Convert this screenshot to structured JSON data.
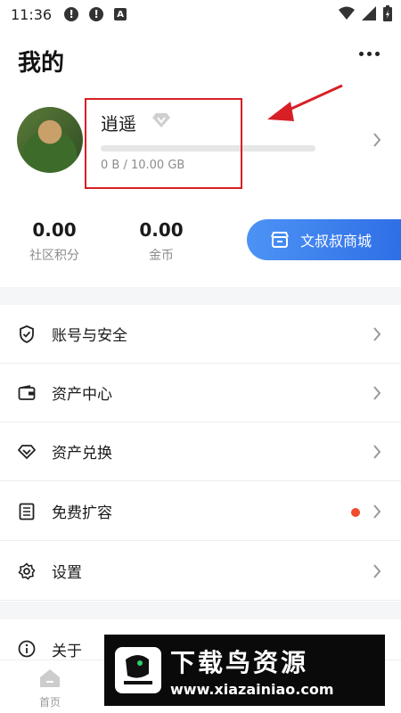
{
  "status_bar": {
    "time": "11:36",
    "ab_label": "A"
  },
  "header": {
    "title": "我的"
  },
  "profile": {
    "username": "逍遥",
    "storage_text": "0 B / 10.00 GB",
    "storage_used_fraction": 0.0
  },
  "stats": {
    "points_value": "0.00",
    "points_label": "社区积分",
    "coins_value": "0.00",
    "coins_label": "金币"
  },
  "shop": {
    "label": "文叔叔商城"
  },
  "menu": [
    {
      "label": "账号与安全",
      "icon": "shield-icon"
    },
    {
      "label": "资产中心",
      "icon": "wallet-icon"
    },
    {
      "label": "资产兑换",
      "icon": "diamond-icon"
    },
    {
      "label": "免费扩容",
      "icon": "list-icon",
      "badge_color": "#f04b2e"
    },
    {
      "label": "设置",
      "icon": "gear-icon"
    },
    {
      "label": "关于",
      "icon": "info-icon"
    }
  ],
  "tabs": [
    {
      "label": "首页",
      "icon": "home-icon"
    }
  ],
  "watermark": {
    "title": "下载鸟资源",
    "url": "www.xiazainiao.com"
  },
  "colors": {
    "accent": "#3b82f6",
    "annotation": "#d81f26",
    "badge": "#f04b2e"
  }
}
